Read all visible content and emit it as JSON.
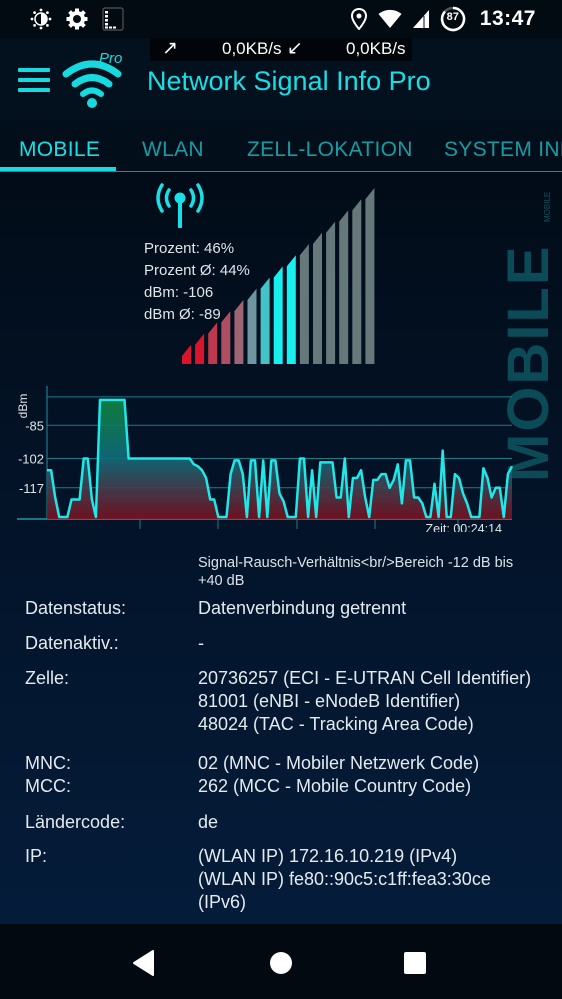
{
  "status_bar": {
    "left_icons": [
      "brightness-auto-icon",
      "settings-icon",
      "signal-stats-icon"
    ],
    "right_icons": [
      "location-icon",
      "wifi-icon",
      "cell-signal-icon",
      "battery-icon"
    ],
    "battery_percent": "87",
    "time": "13:47"
  },
  "speed": {
    "upload_icon": "arrow-up-right-icon",
    "upload": "0,0KB/s",
    "download_icon": "arrow-down-left-icon",
    "download": "0,0KB/s"
  },
  "app_bar": {
    "menu_icon": "hamburger-menu-icon",
    "logo_icon": "wifi-pro-logo-icon",
    "logo_badge": "Pro",
    "title": "Network Signal Info Pro"
  },
  "tabs": [
    {
      "label": "MOBILE",
      "active": true
    },
    {
      "label": "WLAN",
      "active": false
    },
    {
      "label": "ZELL-LOKATION",
      "active": false
    },
    {
      "label": "SYSTEM INFO",
      "active": false
    }
  ],
  "side_label": {
    "big": "MOBILE",
    "small": "MOBILE"
  },
  "signal": {
    "icon": "antenna-tower-icon",
    "percent_label": "Prozent: 46%",
    "percent_avg_label": "Prozent Ø: 44%",
    "dbm_label": "dBm: -106",
    "dbm_avg_label": "dBm Ø: -89",
    "percent": 46,
    "bar_count": 15,
    "active_bars": 9,
    "colors": {
      "red": "#d9152b",
      "mauve": "#9a6878",
      "cyan": "#18f0f0",
      "inactive": "#66787a"
    }
  },
  "chart_data": {
    "type": "area",
    "title": "",
    "ylabel": "dBm",
    "xlabel": "Zeit: 00:24:14",
    "yticks": [
      -85,
      -102,
      -117
    ],
    "ylim": [
      -133,
      -69
    ],
    "grid": true,
    "series": [
      {
        "name": "signal",
        "values": [
          -108,
          -108,
          -122,
          -132,
          -132,
          -132,
          -123,
          -123,
          -123,
          -102,
          -102,
          -123,
          -132,
          -72,
          -72,
          -72,
          -72,
          -72,
          -72,
          -72,
          -102,
          -102,
          -102,
          -102,
          -102,
          -102,
          -102,
          -102,
          -102,
          -102,
          -102,
          -102,
          -102,
          -102,
          -102,
          -102,
          -105,
          -106,
          -108,
          -112,
          -123,
          -123,
          -132,
          -132,
          -132,
          -110,
          -103,
          -103,
          -110,
          -132,
          -103,
          -103,
          -132,
          -103,
          -132,
          -103,
          -103,
          -120,
          -124,
          -132,
          -132,
          -132,
          -102,
          -102,
          -132,
          -108,
          -132,
          -104,
          -104,
          -104,
          -104,
          -122,
          -122,
          -102,
          -132,
          -112,
          -112,
          -108,
          -122,
          -132,
          -113,
          -113,
          -110,
          -110,
          -117,
          -113,
          -105,
          -125,
          -103,
          -103,
          -122,
          -122,
          -125,
          -132,
          -132,
          -115,
          -132,
          -98,
          -132,
          -132,
          -110,
          -112,
          -120,
          -125,
          -132,
          -132,
          -132,
          -107,
          -112,
          -122,
          -117,
          -117,
          -132,
          -110,
          -106
        ]
      }
    ],
    "line_color": "#1ee8e8",
    "fill_top_color": "#0f8a3a",
    "fill_mid_color": "#0f6f7c",
    "fill_bottom_color": "#7a1020"
  },
  "snr_note": "Signal-Rausch-Verhältnis<br/>Bereich -12 dB bis +40 dB",
  "info": [
    {
      "label": [
        "Datenstatus:"
      ],
      "value": [
        "Datenverbindung getrennt"
      ]
    },
    {
      "label": [
        "Datenaktiv.:"
      ],
      "value": [
        "-"
      ]
    },
    {
      "label": [
        "Zelle:"
      ],
      "value": [
        "20736257 (ECI - E-UTRAN Cell Identifier)",
        "81001 (eNBI - eNodeB Identifier)",
        "48024 (TAC - Tracking Area Code)"
      ]
    },
    {
      "label": [
        "MNC:",
        "MCC:"
      ],
      "value": [
        "02 (MNC - Mobiler Netzwerk Code)",
        "262 (MCC - Mobile Country Code)"
      ]
    },
    {
      "label": [
        "Ländercode:"
      ],
      "value": [
        "de"
      ]
    },
    {
      "label": [
        "IP:"
      ],
      "value": [
        "(WLAN IP) 172.16.10.219 (IPv4)",
        "(WLAN IP) fe80::90c5:c1ff:fea3:30ce",
        "(IPv6)"
      ]
    }
  ],
  "nav": {
    "back": "back-icon",
    "home": "home-icon",
    "recents": "recents-icon"
  }
}
